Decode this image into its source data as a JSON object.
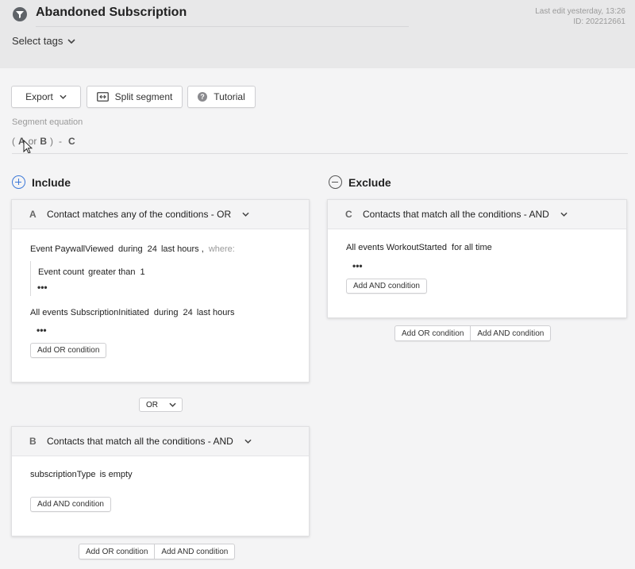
{
  "header": {
    "title": "Abandoned Subscription",
    "last_edit": "Last edit yesterday, 13:26",
    "id": "ID: 202212661",
    "select_tags": "Select tags"
  },
  "toolbar": {
    "export": "Export",
    "split_segment": "Split segment",
    "tutorial": "Tutorial"
  },
  "equation": {
    "label": "Segment equation",
    "open_paren": "(",
    "a": "A",
    "or": "or",
    "b": "B",
    "close_paren": ")",
    "minus": "-",
    "c": "C"
  },
  "include": {
    "title": "Include",
    "group_a": {
      "letter": "A",
      "title": "Contact matches any of the conditions - OR",
      "cond1": {
        "event": "Event PaywallViewed",
        "during": "during",
        "num": "24",
        "period": "last hours",
        "comma": ",",
        "where": "where:"
      },
      "sub1": {
        "text": "Event count",
        "op": "greater than",
        "value": "1"
      },
      "cond2": {
        "event": "All events SubscriptionInitiated",
        "during": "during",
        "num": "24",
        "period": "last hours"
      },
      "dots": "•••",
      "add_or": "Add OR condition"
    },
    "or_select": "OR",
    "group_b": {
      "letter": "B",
      "title": "Contacts that match all the conditions - AND",
      "cond1": {
        "field": "subscriptionType",
        "op": "is empty"
      },
      "add_and": "Add AND condition"
    },
    "footer": {
      "add_or": "Add OR condition",
      "add_and": "Add AND condition"
    }
  },
  "exclude": {
    "title": "Exclude",
    "group_c": {
      "letter": "C",
      "title": "Contacts that match all the conditions - AND",
      "cond1": {
        "event": "All events WorkoutStarted",
        "period": "for all time"
      },
      "dots": "•••",
      "add_and": "Add AND condition"
    },
    "footer": {
      "add_or": "Add OR condition",
      "add_and": "Add AND condition"
    }
  }
}
